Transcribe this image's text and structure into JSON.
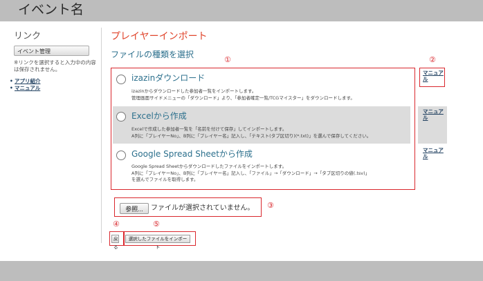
{
  "header": {
    "title": "イベント名"
  },
  "sidebar": {
    "title": "リンク",
    "button_label": "イベント管理",
    "note": "※リンクを選択すると入力中の内容は保存されません。",
    "links": [
      {
        "label": "アプリ紹介"
      },
      {
        "label": "マニュアル"
      }
    ]
  },
  "main": {
    "title": "プレイヤーインポート",
    "section_title": "ファイルの種類を選択",
    "options": [
      {
        "title": "izazinダウンロード",
        "desc_lines": [
          "izazinからダウンロードした参加者一覧をインポートします。",
          "管理画面サイドメニューの「ダウンロード」より、「参加者確定一覧/TCGマイスター」をダウンロードします。"
        ],
        "manual": "マニュアル"
      },
      {
        "title": "Excelから作成",
        "desc_lines": [
          "Excelで作成した参加者一覧を「名前を付けて保存」してインポートします。",
          "A列に「プレイヤーNo」、B列に「プレイヤー名」記入し、「テキスト(タブ区切り)(*.txt)」を選んで保存してください。"
        ],
        "manual": "マニュアル"
      },
      {
        "title": "Google Spread Sheetから作成",
        "desc_lines": [
          "Google Spread Sheetからダウンロードしたファイルをインポートします。",
          "A列に「プレイヤーNo」、B列に「プレイヤー名」記入し、「ファイル」→「ダウンロード」→「タブ区切りの値(.tsv)」",
          "を選んでファイルを取得します。"
        ],
        "manual": "マニュアル"
      }
    ],
    "file": {
      "browse_label": "参照...",
      "status": "ファイルが選択されていません。"
    },
    "back_label": "戻る",
    "import_label": "選択したファイルをインポート"
  },
  "callouts": [
    "①",
    "②",
    "③",
    "④",
    "⑤"
  ],
  "colors": {
    "accent_red": "#d9262c",
    "title_red": "#e0452c",
    "link_blue": "#2b6f8c",
    "header_gray": "#bdbdbd"
  }
}
